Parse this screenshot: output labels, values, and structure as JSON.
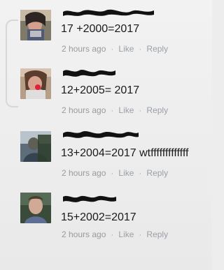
{
  "comments": [
    {
      "text": "17 +2000=2017",
      "time": "2 hours ago",
      "like": "Like",
      "reply": "Reply",
      "separator": "·"
    },
    {
      "text": "12+2005=  2017",
      "time": "2 hours ago",
      "like": "Like",
      "reply": "Reply",
      "separator": "·"
    },
    {
      "text": "13+2004=2017 wtfffffffffffff",
      "time": "2 hours ago",
      "like": "Like",
      "reply": "Reply",
      "separator": "·"
    },
    {
      "text": "15+2002=2017",
      "time": "2 hours ago",
      "like": "Like",
      "reply": "Reply",
      "separator": "·"
    }
  ],
  "colors": {
    "background": "#ededed",
    "text": "#1a1a1a",
    "meta": "#9a9a9a",
    "censor": "#111111"
  },
  "icons": {
    "avatar_1": "avatar",
    "avatar_2": "avatar",
    "avatar_3": "avatar",
    "avatar_4": "avatar"
  }
}
